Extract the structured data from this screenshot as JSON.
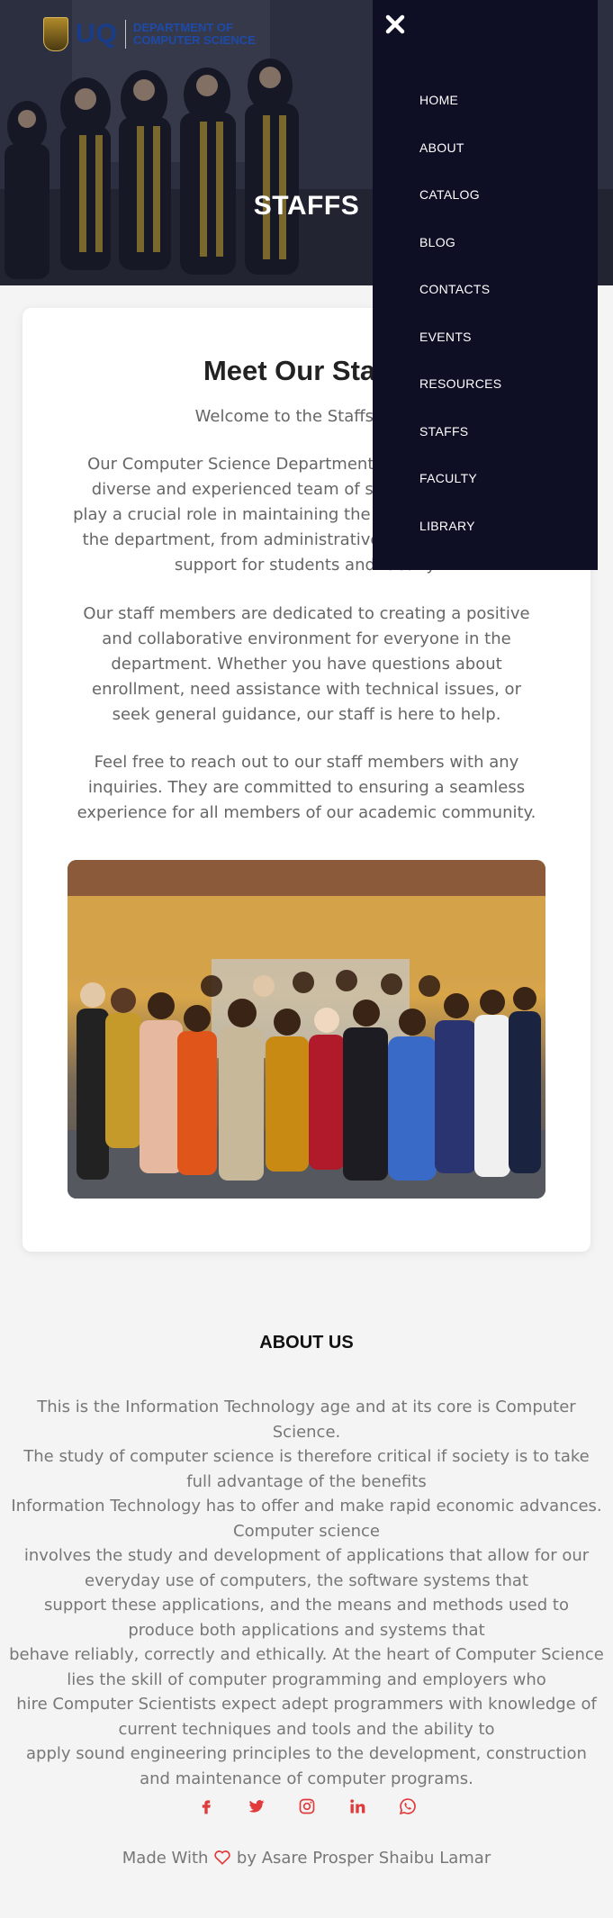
{
  "brand": {
    "logo_text": "UQ",
    "department": "Department of Computer Science",
    "dept_line1": "DEPARTMENT OF",
    "dept_line2": "COMPUTER SCIENCE"
  },
  "hero": {
    "title": "STAFFS"
  },
  "menu": {
    "items": [
      "HOME",
      "ABOUT",
      "CATALOG",
      "BLOG",
      "CONTACTS",
      "EVENTS",
      "RESOURCES",
      "STAFFS",
      "FACULTY",
      "LIBRARY"
    ]
  },
  "card": {
    "heading": "Meet Our Staffs",
    "welcome": "Welcome to the Staffs Page",
    "paragraphs": [
      "Our Computer Science Department is proud to have a diverse and experienced team of staff members who play a crucial role in maintaining the smooth operation of the department, from administrative tasks to providing support for students and faculty.",
      "Our staff members are dedicated to creating a positive and collaborative environment for everyone in the department. Whether you have questions about enrollment, need assistance with technical issues, or seek general guidance, our staff is here to help.",
      "Feel free to reach out to our staff members with any inquiries. They are committed to ensuring a seamless experience for all members of our academic community."
    ]
  },
  "about": {
    "title": "ABOUT US",
    "lines": [
      "This is the Information Technology age and at its core is Computer Science.",
      "The study of computer science is therefore critical if society is to take full advantage of the benefits",
      "Information Technology has to offer and make rapid economic advances. Computer science",
      "involves the study and development of applications that allow for our everyday use of computers, the software systems that",
      "support these applications, and the means and methods used to produce both applications and systems that",
      "behave reliably, correctly and ethically. At the heart of Computer Science lies the skill of computer programming and employers who",
      "hire Computer Scientists expect adept programmers with knowledge of current techniques and tools and the ability to",
      "apply sound engineering principles to the development, construction and maintenance of computer programs."
    ]
  },
  "footer": {
    "made_prefix": "Made With",
    "made_suffix": "by Asare Prosper Shaibu Lamar",
    "socials": [
      "facebook-icon",
      "twitter-icon",
      "instagram-icon",
      "linkedin-icon",
      "whatsapp-icon"
    ],
    "accent": "#e03a3a"
  },
  "colors": {
    "menu_bg": "#0e0e25",
    "accent": "#e03a3a",
    "page_bg": "#f4f4f4"
  }
}
